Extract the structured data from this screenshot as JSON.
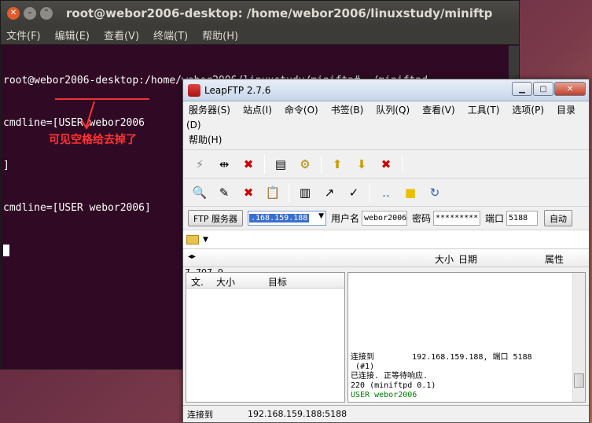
{
  "terminal": {
    "title": "root@webor2006-desktop: /home/webor2006/linuxstudy/miniftp",
    "menu": [
      "文件(F)",
      "编辑(E)",
      "查看(V)",
      "终端(T)",
      "帮助(H)"
    ],
    "lines": [
      "root@webor2006-desktop:/home/webor2006/linuxstudy/miniftp# ./miniftpd",
      "cmdline=[USER webor2006",
      "]",
      "cmdline=[USER webor2006]"
    ],
    "annotation": "可见空格给去掉了",
    "colors": {
      "background": "#300a24",
      "annotation": "#ff3333"
    }
  },
  "leapftp": {
    "title": "LeapFTP 2.7.6",
    "menu": [
      "服务器(S)",
      "站点(I)",
      "命令(O)",
      "书签(B)",
      "队列(Q)",
      "查看(V)",
      "工具(T)",
      "选项(P)",
      "目录(D)",
      "帮助(H)"
    ],
    "server_button": "FTP 服务器",
    "host_value": ".168.159.188",
    "username_label": "用户名",
    "username_value": "webor2006",
    "password_label": "密码",
    "password_value": "*********",
    "port_label": "端口",
    "port_value": "5188",
    "auto_button": "自动",
    "remote_columns": {
      "size": "大小",
      "date": "日期",
      "attr": "属性"
    },
    "coords_text": "7, 707, 9",
    "queue_columns": {
      "file": "文.",
      "size": "大小",
      "target": "目标"
    },
    "log": [
      {
        "text": "连接到        192.168.159.188, 端口 5188",
        "color": "#000000"
      },
      {
        "text": " (#1)",
        "color": "#000000"
      },
      {
        "text": "已连接. 正等待响应.",
        "color": "#000000"
      },
      {
        "text": "220 (miniftpd 0.1)",
        "color": "#000000"
      },
      {
        "text": "USER webor2006",
        "color": "#008000"
      }
    ],
    "status_left": "连接到",
    "status_right": "192.168.159.188:5188"
  }
}
